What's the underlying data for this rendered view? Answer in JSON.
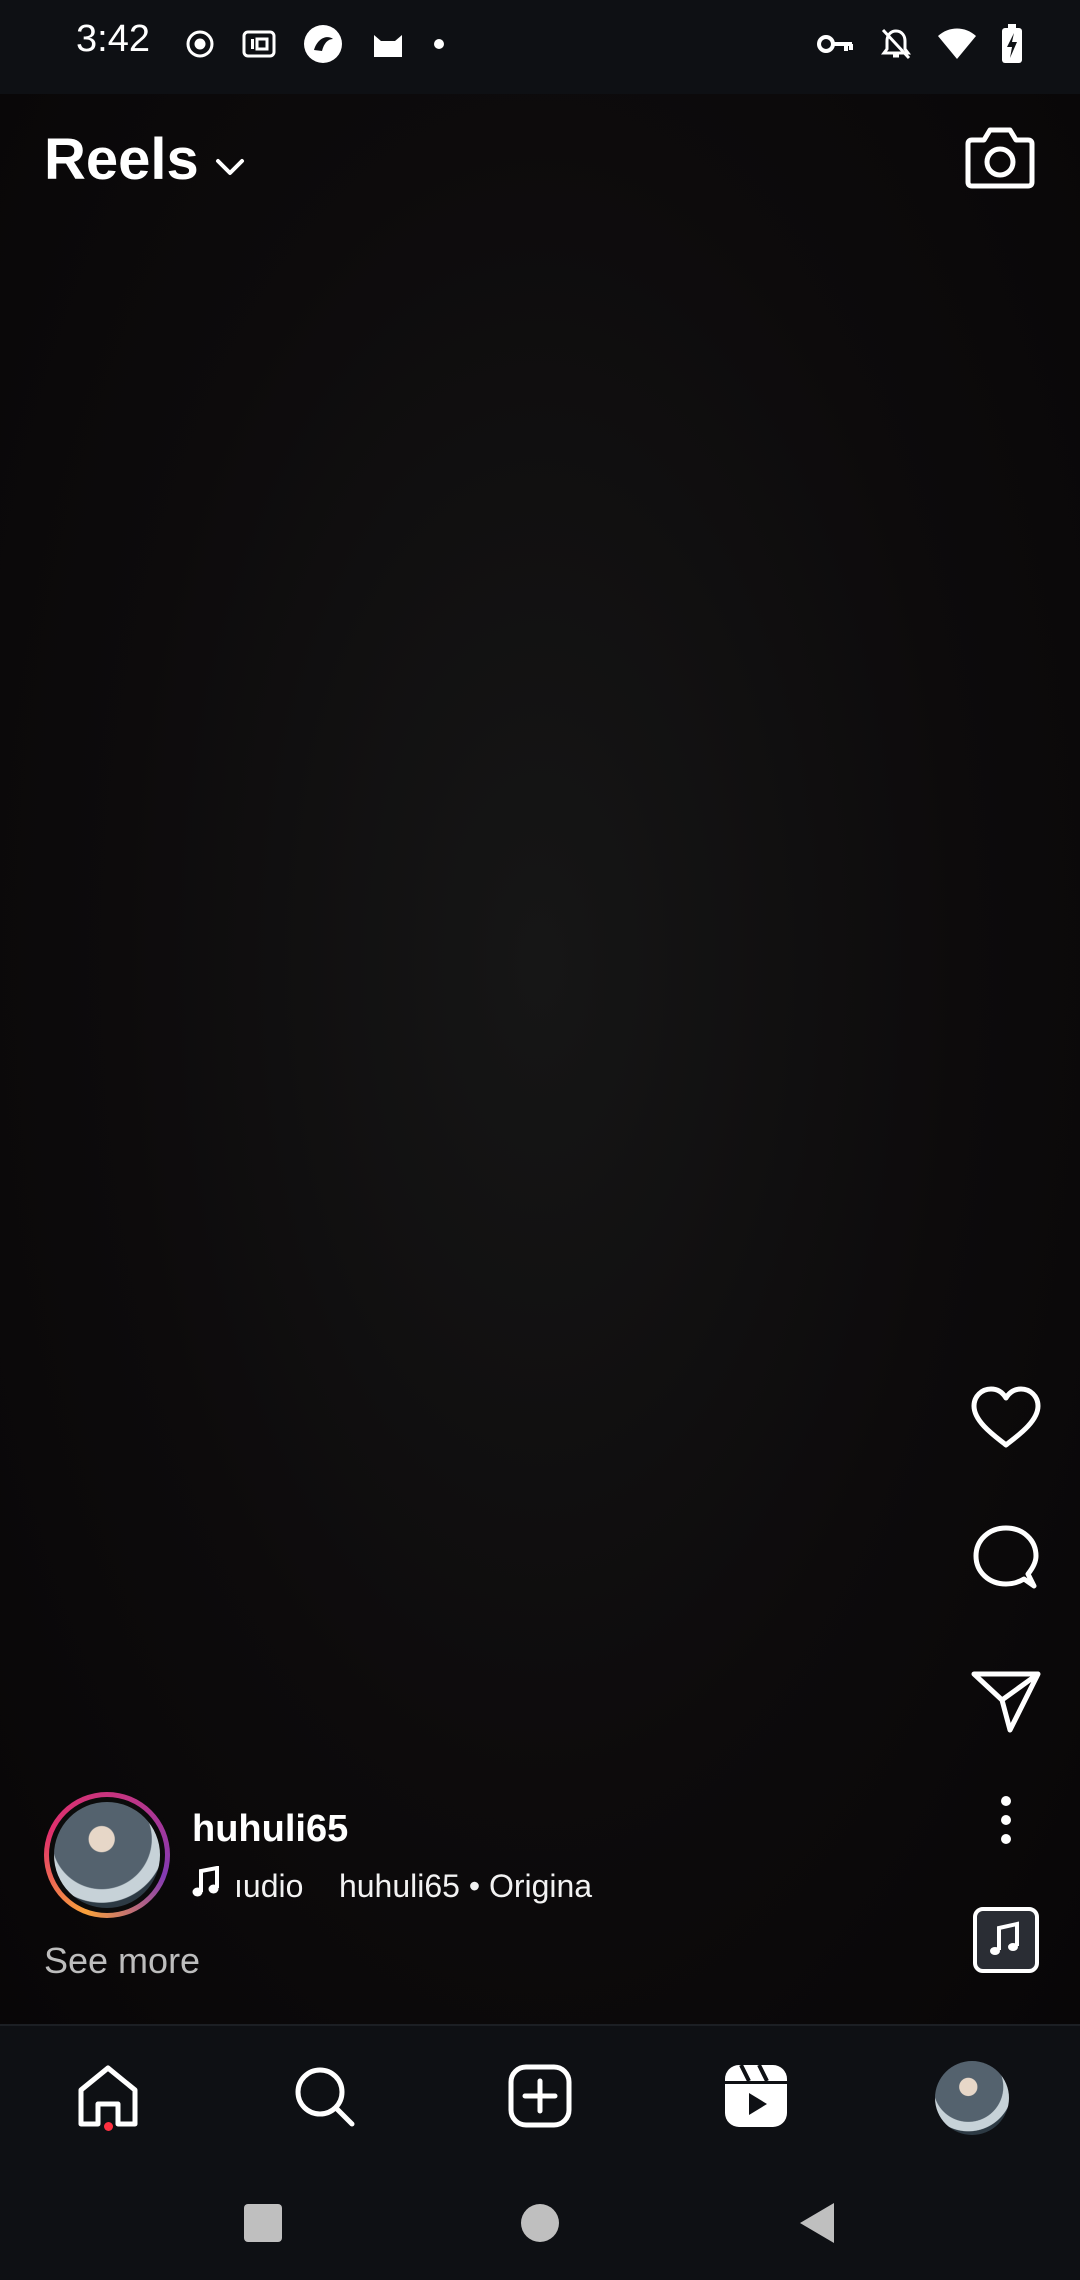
{
  "status_bar": {
    "time": "3:42",
    "left_icons": [
      "record-icon",
      "iqiyi-icon",
      "app-icon",
      "cat-app-icon",
      "dot-icon"
    ],
    "right_icons": [
      "vpn-key-icon",
      "bell-muted-icon",
      "wifi-icon",
      "battery-charging-icon"
    ]
  },
  "header": {
    "title": "Reels",
    "dropdown_icon": "chevron-down-icon",
    "camera_icon": "camera-icon"
  },
  "actions": {
    "like_icon": "heart-icon",
    "comment_icon": "comment-icon",
    "share_icon": "send-icon",
    "more_icon": "more-vertical-icon",
    "audio_icon": "music-note-icon"
  },
  "post": {
    "username": "huhuli65",
    "music_text": "ıudio    huhuli65 • Origina",
    "see_more": "See more"
  },
  "bottom_nav": {
    "items": [
      "home-icon",
      "search-icon",
      "create-icon",
      "reels-icon",
      "profile-avatar"
    ],
    "active": "reels-icon",
    "notification_color": "#ff3040"
  },
  "system_nav": [
    "recents-button",
    "home-button",
    "back-button"
  ]
}
